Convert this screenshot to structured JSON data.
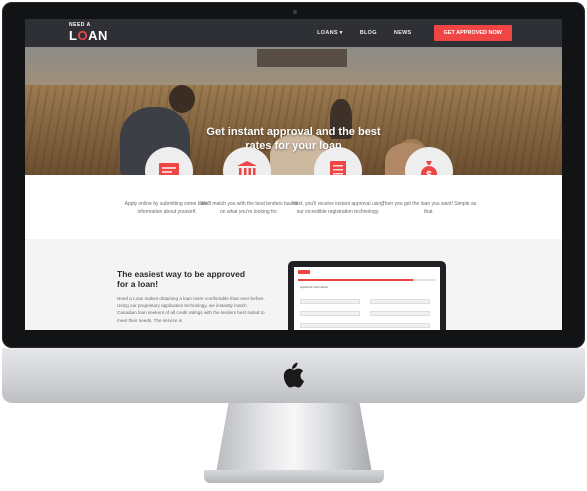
{
  "nav": {
    "logo_small": "NEED A",
    "logo_big_pre": "L",
    "logo_big_o": "O",
    "logo_big_post": "AN",
    "items": [
      {
        "label": "LOANS ▾"
      },
      {
        "label": "BLOG"
      },
      {
        "label": "NEWS"
      }
    ],
    "cta": "GET APPROVED NOW"
  },
  "hero": {
    "title_line1": "Get instant approval and the best",
    "title_line2": "rates for your loan"
  },
  "steps": [
    {
      "text": "Apply online by submitting some basic information about yourself.",
      "icon": "form-icon",
      "badge_icon": "cursor-icon"
    },
    {
      "text": "We'll match you with the best lenders based on what you're looking for.",
      "icon": "bank-icon",
      "badge_icon": "link-icon"
    },
    {
      "text": "Next, you'll receive instant approval using our incredible registration technology.",
      "icon": "document-icon",
      "badge_icon": "checkmark-icon"
    },
    {
      "text": "Then you get the loan you want! Simple as that.",
      "icon": "money-bag-icon",
      "badge_icon": "hand-icon"
    }
  ],
  "lower": {
    "title": "The easiest way to be approved for a loan!",
    "body": "Need a Loan makes obtaining a loan more comfortable than ever before. Using our proprietary application technology, we instantly match Canadian loan seekers of all credit ratings with the lenders best suited to meet their needs. The service is"
  },
  "mini_screen": {
    "heading": "Applicant Information"
  },
  "colors": {
    "accent": "#ef4545",
    "nav_bg": "#2e3035"
  }
}
